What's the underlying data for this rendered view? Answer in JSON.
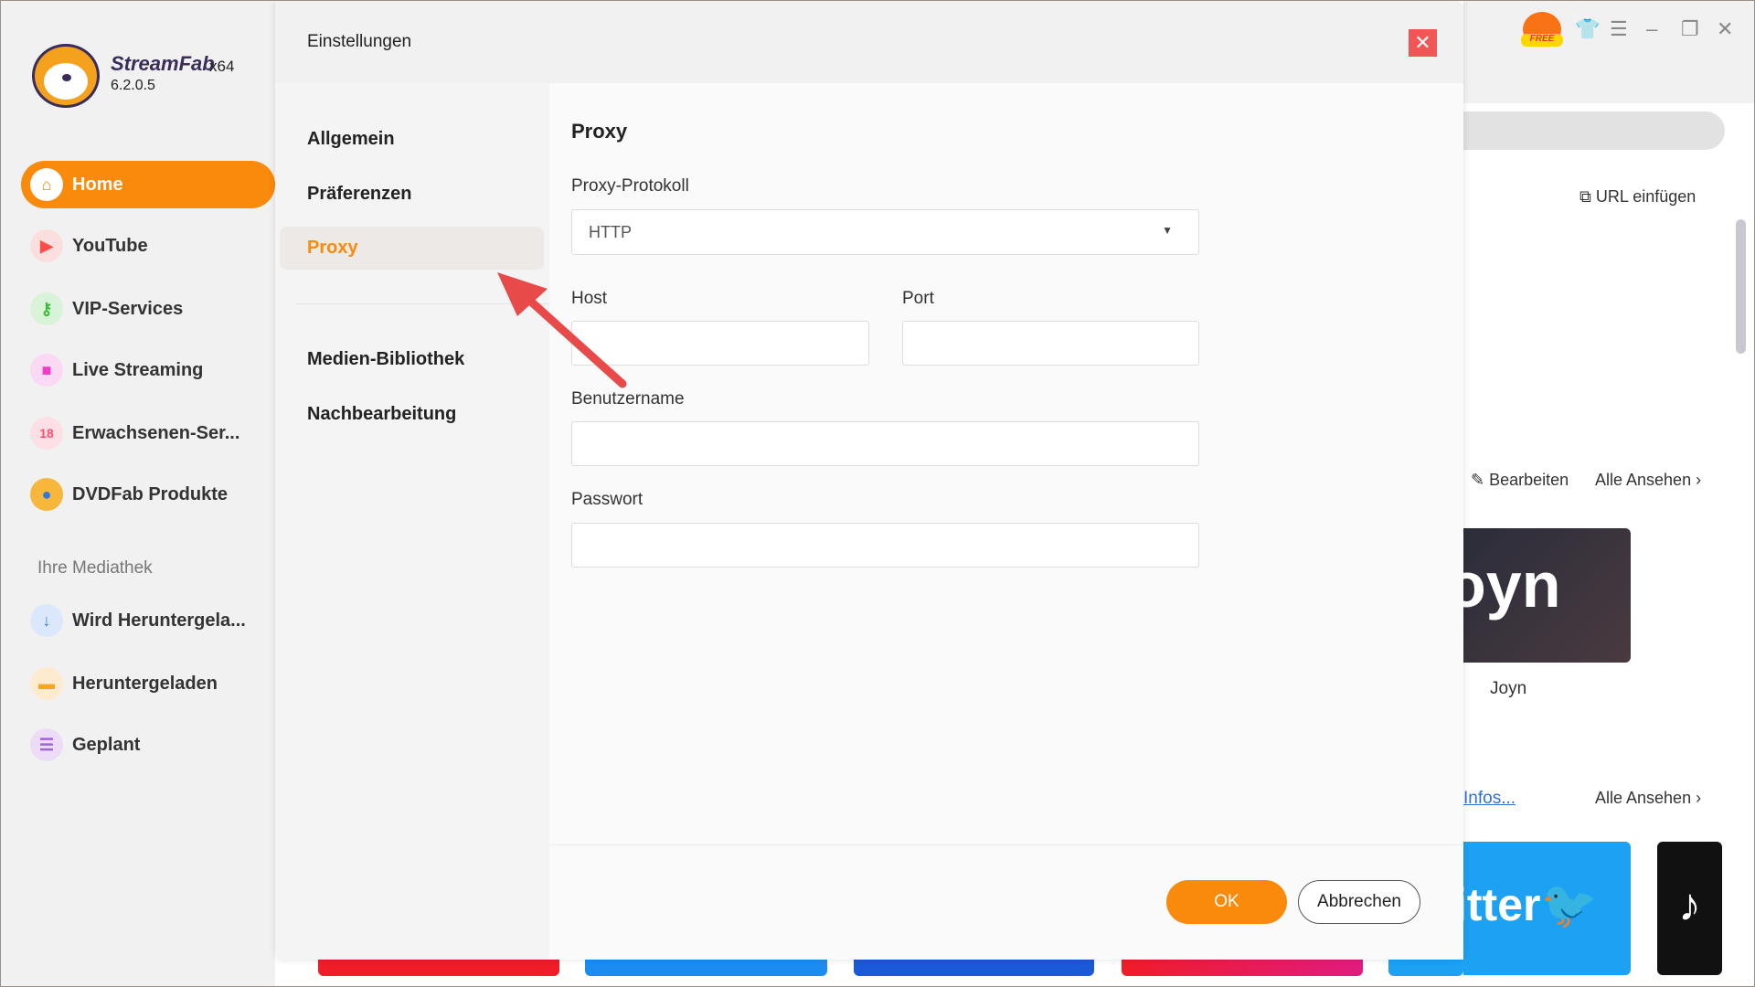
{
  "app": {
    "name": "StreamFab",
    "arch": "x64",
    "version": "6.2.0.5"
  },
  "sidebar": {
    "items": [
      {
        "label": "Home",
        "icon": "home-icon",
        "color": "#f98a0c",
        "active": true
      },
      {
        "label": "YouTube",
        "icon": "youtube-icon",
        "color": "#ff4d4d"
      },
      {
        "label": "VIP-Services",
        "icon": "key-icon",
        "color": "#3dbb3d"
      },
      {
        "label": "Live Streaming",
        "icon": "camera-icon",
        "color": "#f03cc8"
      },
      {
        "label": "Erwachsenen-Ser...",
        "icon": "adult-icon",
        "color": "#ff4d6d"
      },
      {
        "label": "DVDFab Produkte",
        "icon": "dvdfab-icon",
        "color": "#2b7bd8"
      }
    ],
    "library_title": "Ihre Mediathek",
    "library": [
      {
        "label": "Wird Heruntergela...",
        "icon": "download-icon",
        "color": "#2f7fe0"
      },
      {
        "label": "Heruntergeladen",
        "icon": "folder-icon",
        "color": "#f5a623"
      },
      {
        "label": "Geplant",
        "icon": "list-icon",
        "color": "#a064d8"
      }
    ]
  },
  "main": {
    "url_paste": "URL einfügen",
    "edit": "Bearbeiten",
    "see_all": "Alle Ansehen",
    "joyn_label": "Joyn",
    "infos": "Infos...",
    "free_badge": "FREE"
  },
  "dialog": {
    "title": "Einstellungen",
    "nav": [
      "Allgemein",
      "Präferenzen",
      "Proxy",
      "Medien-Bibliothek",
      "Nachbearbeitung"
    ],
    "active_nav": "Proxy",
    "section_title": "Proxy",
    "protocol_label": "Proxy-Protokoll",
    "protocol_value": "HTTP",
    "host_label": "Host",
    "host_value": "",
    "port_label": "Port",
    "port_value": "",
    "user_label": "Benutzername",
    "user_value": "",
    "pass_label": "Passwort",
    "pass_value": "",
    "ok": "OK",
    "cancel": "Abbrechen",
    "accent": "#f98a0c"
  }
}
